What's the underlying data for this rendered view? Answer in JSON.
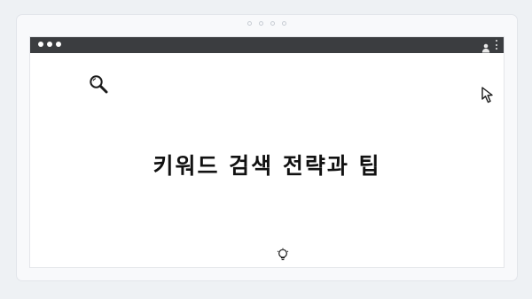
{
  "device": {
    "top_indicator_icon": "four-dot-indicator-icon"
  },
  "browser": {
    "window_controls_icon": "three-dots-window-icon",
    "profile_icon": "user-icon",
    "menu_icon": "kebab-menu-icon"
  },
  "content": {
    "headline": "키워드 검색 전략과 팁",
    "search_icon": "magnifier-icon",
    "cursor_icon": "mouse-pointer-icon",
    "bottom_icon": "lightbulb-icon"
  },
  "colors": {
    "titlebar": "#3b3d40",
    "page_background": "#ffffff",
    "outer_background": "#eef1f4",
    "text": "#111111"
  }
}
